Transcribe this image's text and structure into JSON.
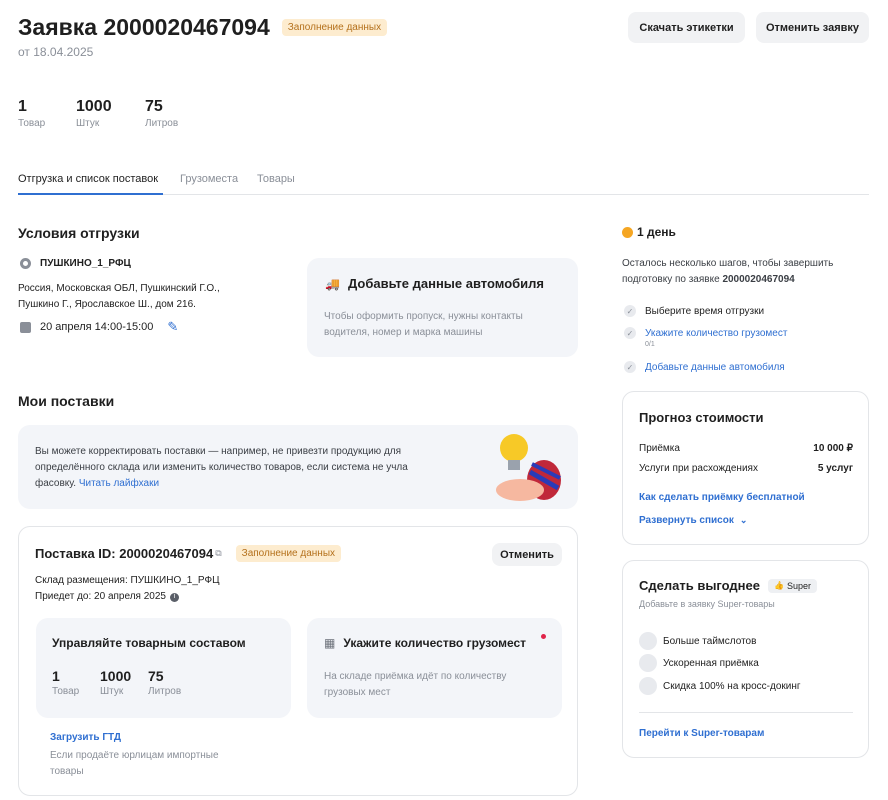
{
  "header": {
    "title": "Заявка 2000020467094",
    "status_badge": "Заполнение данных",
    "date": "от 18.04.2025",
    "download_labels_button": "Скачать этикетки",
    "cancel_request_button": "Отменить заявку"
  },
  "stats": [
    {
      "value": "1",
      "label": "Товар"
    },
    {
      "value": "1000",
      "label": "Штук"
    },
    {
      "value": "75",
      "label": "Литров"
    }
  ],
  "tabs": [
    {
      "label": "Отгрузка и список поставок",
      "active": true
    },
    {
      "label": "Грузоместа",
      "active": false
    },
    {
      "label": "Товары",
      "active": false
    }
  ],
  "shipment": {
    "title": "Условия отгрузки",
    "warehouse": "ПУШКИНО_1_РФЦ",
    "address_line1": "Россия, Московская ОБЛ, Пушкинский Г.О.,",
    "address_line2": "Пушкино Г., Ярославское Ш., дом 216.",
    "datetime": "20 апреля 14:00-15:00",
    "car_card_title": "Добавьте данные автомобиля",
    "car_card_text_line1": "Чтобы оформить пропуск, нужны контакты",
    "car_card_text_line2": "водителя, номер и марка машины"
  },
  "deliveries": {
    "title": "Мои поставки",
    "info_line1": "Вы можете корректировать поставки — например, не привезти продукцию для",
    "info_line2": "определённого склада или изменить количество товаров, если система не учла",
    "info_line3": "фасовку.",
    "info_link": "Читать лайфхаки",
    "delivery_id": "Поставка ID: 2000020467094",
    "delivery_badge": "Заполнение данных",
    "cancel_button": "Отменить",
    "warehouse_line": "Склад размещения: ПУШКИНО_1_РФЦ",
    "arrival_line": "Приедет до: 20 апреля 2025",
    "manage_title": "Управляйте товарным составом",
    "manage_stats": [
      {
        "value": "1",
        "label": "Товар"
      },
      {
        "value": "1000",
        "label": "Штук"
      },
      {
        "value": "75",
        "label": "Литров"
      }
    ],
    "cargo_title": "Укажите количество грузомест",
    "cargo_text_line1": "На складе приёмка идёт по количеству",
    "cargo_text_line2": "грузовых мест",
    "gtd_link": "Загрузить ГТД",
    "gtd_text_line1": "Если продаёте юрлицам импортные",
    "gtd_text_line2": "товары"
  },
  "sidebar": {
    "timer": "1 день",
    "steps_text_line1": "Осталось несколько шагов, чтобы завершить",
    "steps_text_line2_prefix": "подготовку по заявке ",
    "steps_text_line2_bold": "2000020467094",
    "steps": [
      {
        "label": "Выберите время отгрузки",
        "link": false,
        "sub": ""
      },
      {
        "label": "Укажите количество грузомест",
        "link": true,
        "sub": "0/1"
      },
      {
        "label": "Добавьте данные автомобиля",
        "link": true,
        "sub": ""
      }
    ],
    "cost": {
      "title": "Прогноз стоимости",
      "rows": [
        {
          "label": "Приёмка",
          "value": "10 000 ₽"
        },
        {
          "label": "Услуги при расхождениях",
          "value": "5 услуг"
        }
      ],
      "free_link": "Как сделать приёмку бесплатной",
      "expand_link": "Развернуть список"
    },
    "super": {
      "title": "Сделать выгоднее",
      "badge": "Super",
      "subtitle": "Добавьте в заявку Super-товары",
      "items": [
        "Больше таймслотов",
        "Ускоренная приёмка",
        "Скидка 100% на кросс-докинг"
      ],
      "link": "Перейти к Super-товарам"
    }
  },
  "colors": {
    "accent": "#2f6fd1",
    "badge_bg": "#fdeccf",
    "badge_text": "#b4701b",
    "timer": "#f5a623",
    "panel": "#f3f5f9"
  }
}
